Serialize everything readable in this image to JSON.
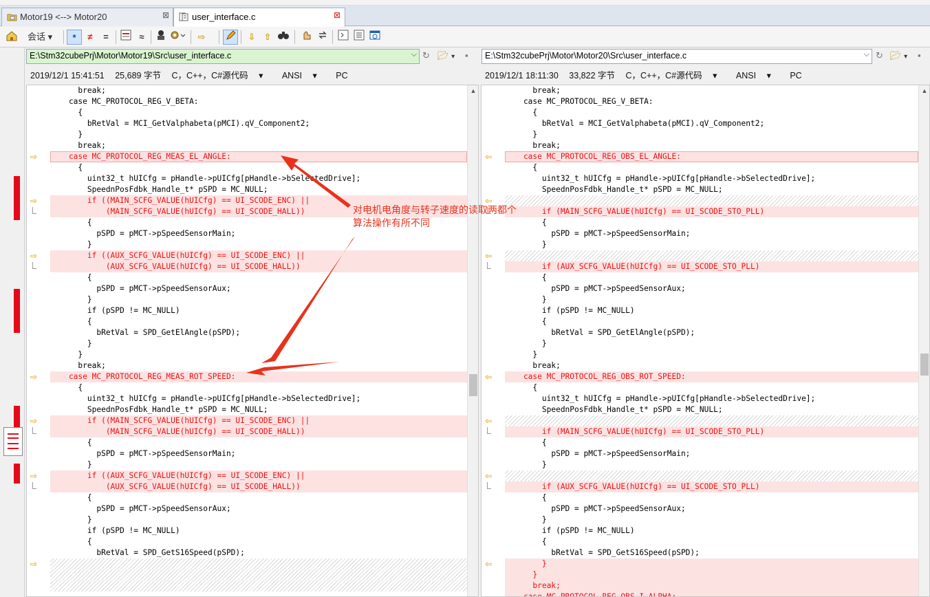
{
  "tabs": [
    {
      "label": "Motor19 <--> Motor20",
      "close": "⊠"
    },
    {
      "label": "user_interface.c",
      "close": "⊠"
    }
  ],
  "toolbar": {
    "session_label": "会话",
    "buttons": [
      "home",
      "session",
      "show-all",
      "show-diffs",
      "show-same",
      "diff-blocks",
      "approx",
      "rules",
      "format",
      "next-section",
      "edit",
      "prev-diff",
      "next-diff",
      "find",
      "copy",
      "swap",
      "expand",
      "collapse",
      "browser"
    ]
  },
  "left": {
    "path": "E:\\Stm32cubePrj\\Motor\\Motor19\\Src\\user_interface.c",
    "date": "2019/12/1 15:41:51",
    "size": "25,689 字节",
    "type": "C，C++，C#源代码",
    "encoding": "ANSI",
    "eol": "PC",
    "lines": [
      {
        "t": "      break;",
        "s": "n"
      },
      {
        "t": "    case MC_PROTOCOL_REG_V_BETA:",
        "s": "n"
      },
      {
        "t": "      {",
        "s": "n"
      },
      {
        "t": "        bRetVal = MCI_GetValphabeta(pMCI).qV_Component2;",
        "s": "n"
      },
      {
        "t": "      }",
        "s": "n"
      },
      {
        "t": "      break;",
        "s": "n"
      },
      {
        "t": "    case MC_PROTOCOL_REG_MEAS_EL_ANGLE:",
        "s": "d",
        "m": "arrow",
        "sel": true
      },
      {
        "t": "      {",
        "s": "n"
      },
      {
        "t": "        uint32_t hUICfg = pHandle->pUICfg[pHandle->bSelectedDrive];",
        "s": "n"
      },
      {
        "t": "        SpeednPosFdbk_Handle_t* pSPD = MC_NULL;",
        "s": "n"
      },
      {
        "t": "        if ((MAIN_SCFG_VALUE(hUICfg) == UI_SCODE_ENC) ||",
        "s": "d",
        "m": "arrow"
      },
      {
        "t": "            (MAIN_SCFG_VALUE(hUICfg) == UI_SCODE_HALL))",
        "s": "d",
        "m": "bar"
      },
      {
        "t": "        {",
        "s": "n"
      },
      {
        "t": "          pSPD = pMCT->pSpeedSensorMain;",
        "s": "n"
      },
      {
        "t": "        }",
        "s": "n"
      },
      {
        "t": "        if ((AUX_SCFG_VALUE(hUICfg) == UI_SCODE_ENC) ||",
        "s": "d",
        "m": "arrow"
      },
      {
        "t": "            (AUX_SCFG_VALUE(hUICfg) == UI_SCODE_HALL))",
        "s": "d",
        "m": "bar"
      },
      {
        "t": "        {",
        "s": "n"
      },
      {
        "t": "          pSPD = pMCT->pSpeedSensorAux;",
        "s": "n"
      },
      {
        "t": "        }",
        "s": "n"
      },
      {
        "t": "        if (pSPD != MC_NULL)",
        "s": "n"
      },
      {
        "t": "        {",
        "s": "n"
      },
      {
        "t": "          bRetVal = SPD_GetElAngle(pSPD);",
        "s": "n"
      },
      {
        "t": "        }",
        "s": "n"
      },
      {
        "t": "      }",
        "s": "n"
      },
      {
        "t": "      break;",
        "s": "n"
      },
      {
        "t": "    case MC_PROTOCOL_REG_MEAS_ROT_SPEED:",
        "s": "d",
        "m": "arrow"
      },
      {
        "t": "      {",
        "s": "n"
      },
      {
        "t": "        uint32_t hUICfg = pHandle->pUICfg[pHandle->bSelectedDrive];",
        "s": "n"
      },
      {
        "t": "        SpeednPosFdbk_Handle_t* pSPD = MC_NULL;",
        "s": "n"
      },
      {
        "t": "        if ((MAIN_SCFG_VALUE(hUICfg) == UI_SCODE_ENC) ||",
        "s": "d",
        "m": "arrow"
      },
      {
        "t": "            (MAIN_SCFG_VALUE(hUICfg) == UI_SCODE_HALL))",
        "s": "d",
        "m": "bar"
      },
      {
        "t": "        {",
        "s": "n"
      },
      {
        "t": "          pSPD = pMCT->pSpeedSensorMain;",
        "s": "n"
      },
      {
        "t": "        }",
        "s": "n"
      },
      {
        "t": "        if ((AUX_SCFG_VALUE(hUICfg) == UI_SCODE_ENC) ||",
        "s": "d",
        "m": "arrow"
      },
      {
        "t": "            (AUX_SCFG_VALUE(hUICfg) == UI_SCODE_HALL))",
        "s": "d",
        "m": "bar"
      },
      {
        "t": "        {",
        "s": "n"
      },
      {
        "t": "          pSPD = pMCT->pSpeedSensorAux;",
        "s": "n"
      },
      {
        "t": "        }",
        "s": "n"
      },
      {
        "t": "        if (pSPD != MC_NULL)",
        "s": "n"
      },
      {
        "t": "        {",
        "s": "n"
      },
      {
        "t": "          bRetVal = SPD_GetS16Speed(pSPD);",
        "s": "n"
      },
      {
        "t": "",
        "s": "h",
        "m": "arrow"
      },
      {
        "t": "",
        "s": "h"
      },
      {
        "t": "",
        "s": "h"
      }
    ]
  },
  "right": {
    "path": "E:\\Stm32cubePrj\\Motor\\Motor20\\Src\\user_interface.c",
    "date": "2019/12/1 18:11:30",
    "size": "33,822 字节",
    "type": "C，C++，C#源代码",
    "encoding": "ANSI",
    "eol": "PC",
    "lines": [
      {
        "t": "      break;",
        "s": "n"
      },
      {
        "t": "    case MC_PROTOCOL_REG_V_BETA:",
        "s": "n"
      },
      {
        "t": "      {",
        "s": "n"
      },
      {
        "t": "        bRetVal = MCI_GetValphabeta(pMCI).qV_Component2;",
        "s": "n"
      },
      {
        "t": "      }",
        "s": "n"
      },
      {
        "t": "      break;",
        "s": "n"
      },
      {
        "t": "    case MC_PROTOCOL_REG_OBS_EL_ANGLE:",
        "s": "d",
        "m": "arrow",
        "sel": true
      },
      {
        "t": "      {",
        "s": "n"
      },
      {
        "t": "        uint32_t hUICfg = pHandle->pUICfg[pHandle->bSelectedDrive];",
        "s": "n"
      },
      {
        "t": "        SpeednPosFdbk_Handle_t* pSPD = MC_NULL;",
        "s": "n"
      },
      {
        "t": "",
        "s": "h",
        "m": "arrow"
      },
      {
        "t": "        if (MAIN_SCFG_VALUE(hUICfg) == UI_SCODE_STO_PLL)",
        "s": "d",
        "m": "bar"
      },
      {
        "t": "        {",
        "s": "n"
      },
      {
        "t": "          pSPD = pMCT->pSpeedSensorMain;",
        "s": "n"
      },
      {
        "t": "        }",
        "s": "n"
      },
      {
        "t": "",
        "s": "h",
        "m": "arrow"
      },
      {
        "t": "        if (AUX_SCFG_VALUE(hUICfg) == UI_SCODE_STO_PLL)",
        "s": "d",
        "m": "bar"
      },
      {
        "t": "        {",
        "s": "n"
      },
      {
        "t": "          pSPD = pMCT->pSpeedSensorAux;",
        "s": "n"
      },
      {
        "t": "        }",
        "s": "n"
      },
      {
        "t": "        if (pSPD != MC_NULL)",
        "s": "n"
      },
      {
        "t": "        {",
        "s": "n"
      },
      {
        "t": "          bRetVal = SPD_GetElAngle(pSPD);",
        "s": "n"
      },
      {
        "t": "        }",
        "s": "n"
      },
      {
        "t": "      }",
        "s": "n"
      },
      {
        "t": "      break;",
        "s": "n"
      },
      {
        "t": "    case MC_PROTOCOL_REG_OBS_ROT_SPEED:",
        "s": "d",
        "m": "arrow"
      },
      {
        "t": "      {",
        "s": "n"
      },
      {
        "t": "        uint32_t hUICfg = pHandle->pUICfg[pHandle->bSelectedDrive];",
        "s": "n"
      },
      {
        "t": "        SpeednPosFdbk_Handle_t* pSPD = MC_NULL;",
        "s": "n"
      },
      {
        "t": "",
        "s": "h",
        "m": "arrow"
      },
      {
        "t": "        if (MAIN_SCFG_VALUE(hUICfg) == UI_SCODE_STO_PLL)",
        "s": "d",
        "m": "bar"
      },
      {
        "t": "        {",
        "s": "n"
      },
      {
        "t": "          pSPD = pMCT->pSpeedSensorMain;",
        "s": "n"
      },
      {
        "t": "        }",
        "s": "n"
      },
      {
        "t": "",
        "s": "h",
        "m": "arrow"
      },
      {
        "t": "        if (AUX_SCFG_VALUE(hUICfg) == UI_SCODE_STO_PLL)",
        "s": "d",
        "m": "bar"
      },
      {
        "t": "        {",
        "s": "n"
      },
      {
        "t": "          pSPD = pMCT->pSpeedSensorAux;",
        "s": "n"
      },
      {
        "t": "        }",
        "s": "n"
      },
      {
        "t": "        if (pSPD != MC_NULL)",
        "s": "n"
      },
      {
        "t": "        {",
        "s": "n"
      },
      {
        "t": "          bRetVal = SPD_GetS16Speed(pSPD);",
        "s": "n"
      },
      {
        "t": "        }",
        "s": "d",
        "m": "arrow"
      },
      {
        "t": "      }",
        "s": "d"
      },
      {
        "t": "      break;",
        "s": "d"
      },
      {
        "t": "    case MC_PROTOCOL_REG_OBS_I_ALPHA:",
        "s": "d"
      }
    ]
  },
  "annotation": {
    "text_line1": "对电机电角度与转子速度的读取两都个",
    "text_line2": "算法操作有所不同",
    "color": "#e8321c"
  },
  "colors": {
    "diff_bg": "#fde2e2",
    "diff_text": "#e11111",
    "marker": "#e5071b",
    "path_bg_left": "#d9f5d0"
  }
}
